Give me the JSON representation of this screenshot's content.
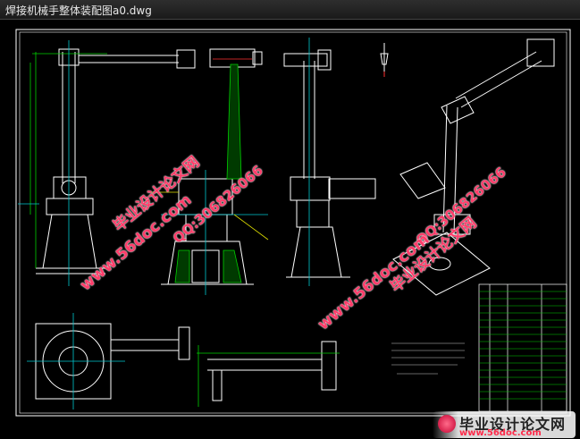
{
  "window": {
    "title": "焊接机械手整体装配图a0.dwg"
  },
  "watermarks": {
    "cn_name": "毕业设计论文网",
    "qq": "QQ:306826066",
    "site": "www.56doc.com"
  },
  "footer": {
    "cn_name": "毕业设计论文网",
    "url": "www.56doc.com"
  },
  "colors": {
    "line_white": "#ffffff",
    "line_green": "#00d000",
    "line_cyan": "#00c8d0",
    "line_yellow": "#e0e000",
    "line_red": "#ff3030",
    "watermark": "#ff3d6a"
  },
  "icons": [
    "logo-icon"
  ]
}
